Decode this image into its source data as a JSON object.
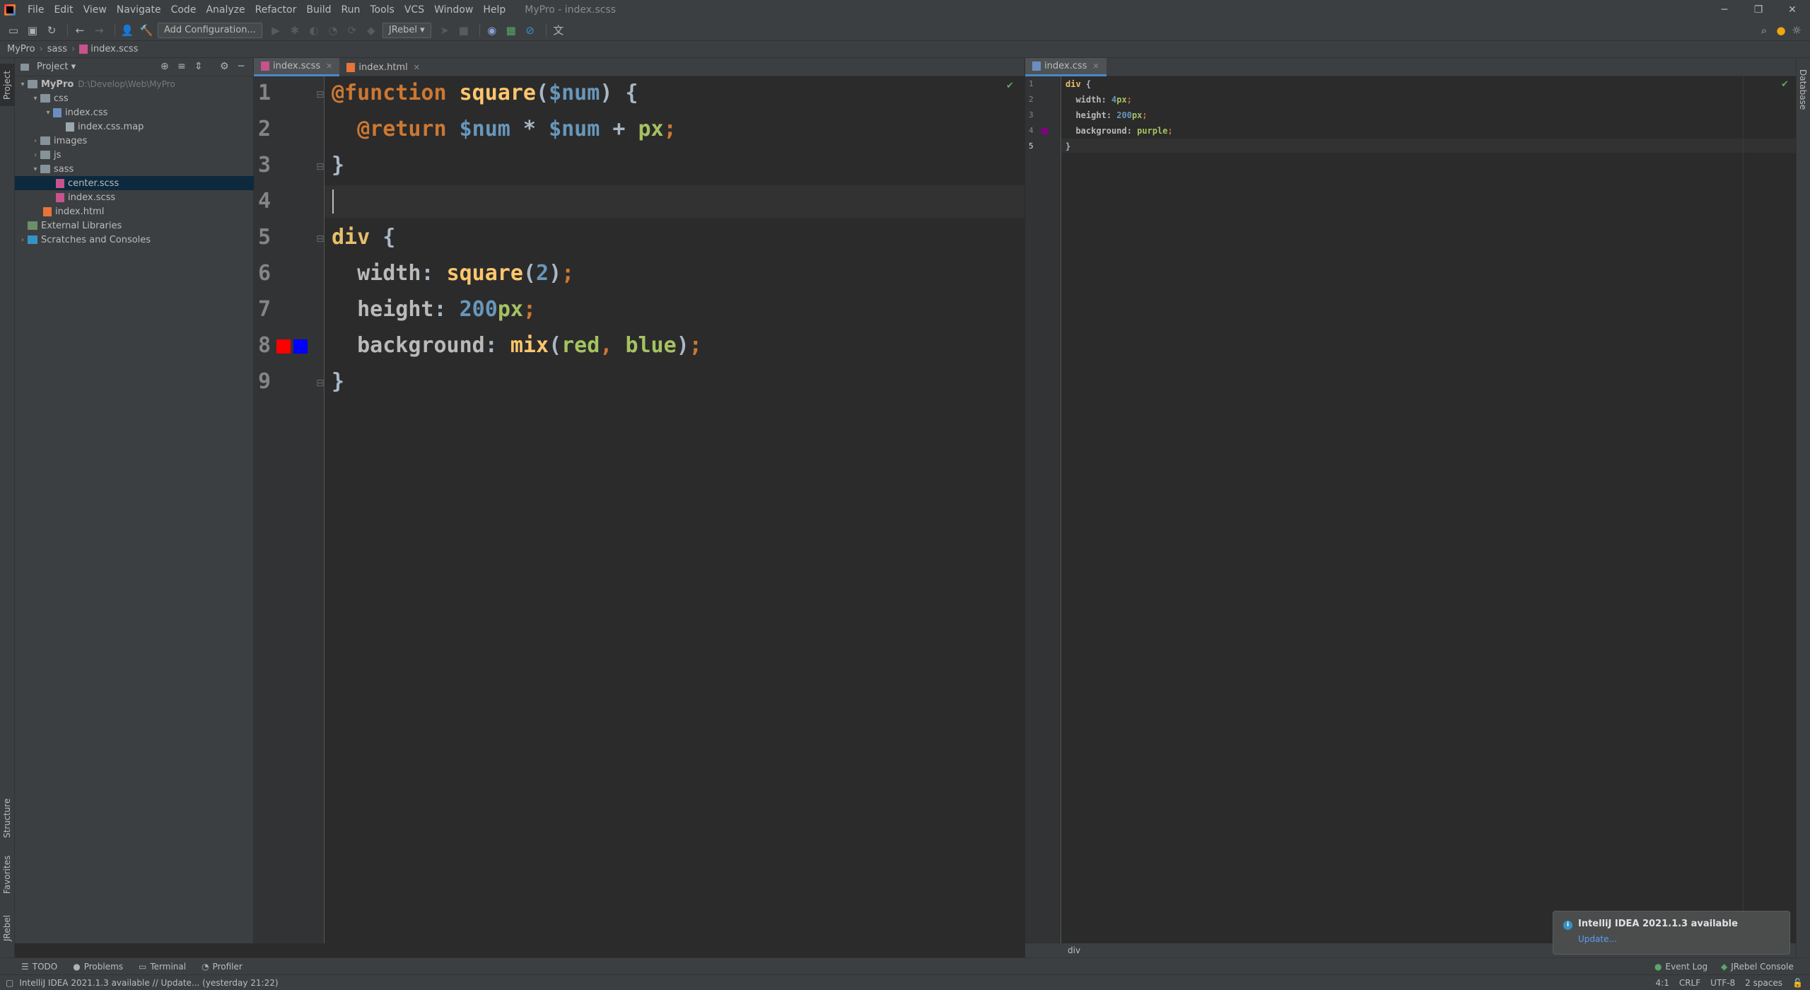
{
  "window": {
    "title": "MyPro - index.scss",
    "menu": [
      "File",
      "Edit",
      "View",
      "Navigate",
      "Code",
      "Analyze",
      "Refactor",
      "Build",
      "Run",
      "Tools",
      "VCS",
      "Window",
      "Help"
    ]
  },
  "toolbar": {
    "add_config_label": "Add Configuration...",
    "jrebel_label": "JRebel"
  },
  "breadcrumb": [
    "MyPro",
    "sass",
    "index.scss"
  ],
  "left_strip": {
    "project": "Project",
    "structure": "Structure",
    "favorites": "Favorites",
    "jrebel": "JRebel"
  },
  "right_strip": {
    "database": "Database"
  },
  "project_panel": {
    "title": "Project",
    "tree": [
      {
        "label": "MyPro",
        "hint": "D:\\Develop\\Web\\MyPro"
      },
      {
        "label": "css"
      },
      {
        "label": "index.css"
      },
      {
        "label": "index.css.map"
      },
      {
        "label": "images"
      },
      {
        "label": "js"
      },
      {
        "label": "sass"
      },
      {
        "label": "center.scss"
      },
      {
        "label": "index.scss"
      },
      {
        "label": "index.html"
      },
      {
        "label": "External Libraries"
      },
      {
        "label": "Scratches and Consoles"
      }
    ]
  },
  "editor_left": {
    "tabs": [
      {
        "label": "index.scss"
      },
      {
        "label": "index.html"
      }
    ],
    "line_numbers": [
      "1",
      "2",
      "3",
      "4",
      "5",
      "6",
      "7",
      "8",
      "9"
    ],
    "lines": [
      [
        "@function",
        " ",
        "square",
        "(",
        "$num",
        ") {"
      ],
      [
        "  ",
        "@return",
        " ",
        "$num",
        " * ",
        "$num",
        " + ",
        "px",
        ";"
      ],
      [
        "}"
      ],
      [
        ""
      ],
      [
        "div",
        " {"
      ],
      [
        "  ",
        "width",
        ": ",
        "square",
        "(",
        "2",
        ")",
        ";"
      ],
      [
        "  ",
        "height",
        ": ",
        "200",
        "px",
        ";"
      ],
      [
        "  ",
        "background",
        ": ",
        "mix",
        "(",
        "red",
        ", ",
        "blue",
        ")",
        ";"
      ],
      [
        "}"
      ]
    ],
    "swatch_colors": [
      "#ff0000",
      "#0000ff"
    ]
  },
  "editor_right": {
    "tabs": [
      {
        "label": "index.css"
      }
    ],
    "line_numbers": [
      "1",
      "2",
      "3",
      "4",
      "5"
    ],
    "lines": [
      [
        "div",
        " {"
      ],
      [
        "  ",
        "width",
        ": ",
        "4",
        "px",
        ";"
      ],
      [
        "  ",
        "height",
        ": ",
        "200",
        "px",
        ";"
      ],
      [
        "  ",
        "background",
        ": ",
        "purple",
        ";"
      ],
      [
        "}"
      ]
    ],
    "swatch_color": "#800080",
    "crumb": "div"
  },
  "tool_windows": {
    "todo": "TODO",
    "problems": "Problems",
    "terminal": "Terminal",
    "profiler": "Profiler",
    "event_log": "Event Log",
    "jrebel_console": "JRebel Console"
  },
  "statusbar": {
    "message": "IntelliJ IDEA 2021.1.3 available // Update... (yesterday 21:22)",
    "position": "4:1",
    "line_sep": "CRLF",
    "encoding": "UTF-8",
    "indent": "2 spaces"
  },
  "notification": {
    "title": "IntelliJ IDEA 2021.1.3 available",
    "link": "Update..."
  }
}
